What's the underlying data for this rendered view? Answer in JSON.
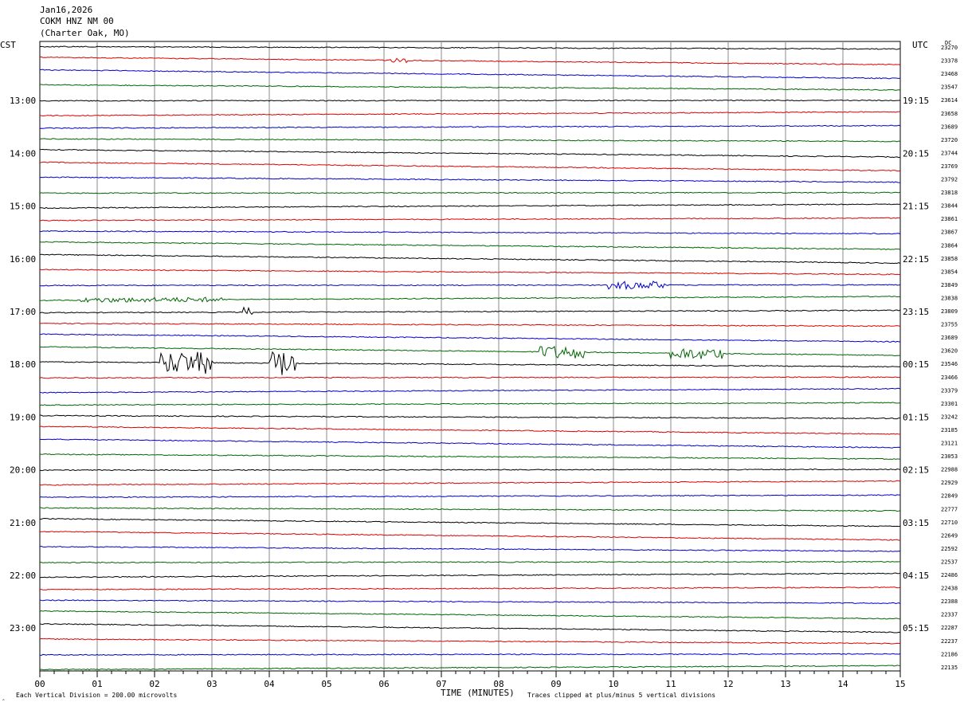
{
  "header": {
    "date": "Jan16,2026",
    "station": "COKM HNZ NM 00",
    "location": "(Charter Oak, MO)"
  },
  "axes": {
    "left_zone": "CST",
    "right_zone": "UTC",
    "dc_label": "DC",
    "xlabel": "TIME (MINUTES)"
  },
  "footer": {
    "left_mark": "‸",
    "vertical_division": "Each Vertical Division =  200.00 microvolts",
    "clip_note": "Traces clipped at plus/minus 5 vertical divisions"
  },
  "chart_data": {
    "type": "line",
    "title": "",
    "x_ticks": [
      "00",
      "01",
      "02",
      "03",
      "04",
      "05",
      "06",
      "07",
      "08",
      "09",
      "10",
      "11",
      "12",
      "13",
      "14",
      "15"
    ],
    "xlim": [
      0,
      15
    ],
    "grid": true,
    "trace_colors": [
      "#000000",
      "#dd0000",
      "#0000cc",
      "#006600"
    ],
    "left_time_labels": [
      "13:00",
      "14:00",
      "15:00",
      "16:00",
      "17:00",
      "18:00",
      "19:00",
      "20:00",
      "21:00",
      "22:00",
      "23:00"
    ],
    "right_time_labels": [
      "19:15",
      "20:15",
      "21:15",
      "22:15",
      "23:15",
      "00:15",
      "01:15",
      "02:15",
      "03:15",
      "04:15",
      "05:15"
    ],
    "dc_values": [
      "23270",
      "23378",
      "23468",
      "23547",
      "23614",
      "23658",
      "23689",
      "23720",
      "23744",
      "23769",
      "23792",
      "23818",
      "23844",
      "23861",
      "23867",
      "23864",
      "23858",
      "23854",
      "23849",
      "23838",
      "23809",
      "23755",
      "23689",
      "23620",
      "23546",
      "23466",
      "23379",
      "23301",
      "23242",
      "23185",
      "23121",
      "23053",
      "22988",
      "22929",
      "22849",
      "22777",
      "22710",
      "22649",
      "22592",
      "22537",
      "22486",
      "22438",
      "22388",
      "22337",
      "22287",
      "22237",
      "22186",
      "22135"
    ],
    "events": [
      {
        "trace": 1,
        "start_min": 6.1,
        "end_min": 6.4,
        "amplitude": 3
      },
      {
        "trace": 18,
        "start_min": 9.9,
        "end_min": 10.9,
        "amplitude": 5
      },
      {
        "trace": 19,
        "start_min": 0.7,
        "end_min": 3.2,
        "amplitude": 3
      },
      {
        "trace": 20,
        "start_min": 3.55,
        "end_min": 3.7,
        "amplitude": 6
      },
      {
        "trace": 23,
        "start_min": 8.7,
        "end_min": 9.5,
        "amplitude": 8
      },
      {
        "trace": 23,
        "start_min": 11.0,
        "end_min": 11.9,
        "amplitude": 7
      },
      {
        "trace": 24,
        "start_min": 2.1,
        "end_min": 3.0,
        "amplitude": 14
      },
      {
        "trace": 24,
        "start_min": 4.0,
        "end_min": 4.45,
        "amplitude": 16
      }
    ]
  }
}
